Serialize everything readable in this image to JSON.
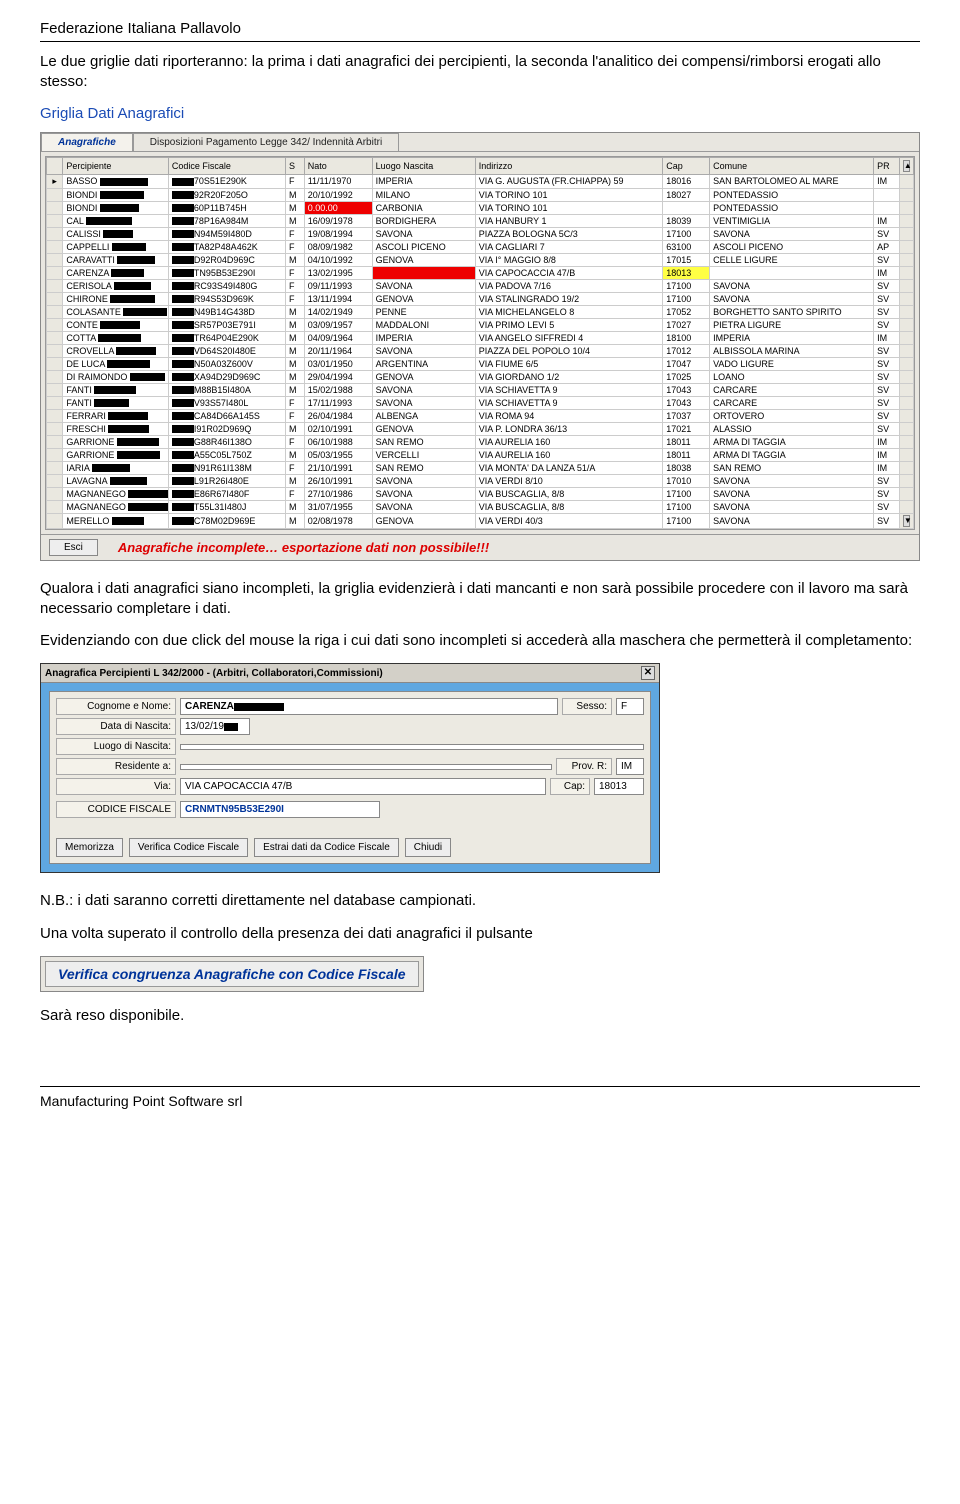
{
  "header": {
    "org": "Federazione Italiana Pallavolo"
  },
  "intro": {
    "p1": "Le due griglie dati riporteranno: la prima i dati anagrafici dei percipienti, la seconda l'analitico dei compensi/rimborsi erogati allo stesso:",
    "section_title": "Griglia Dati Anagrafici"
  },
  "tabs": {
    "active": "Anagrafiche",
    "inactive": "Disposizioni Pagamento Legge 342/ Indennità Arbitri"
  },
  "grid": {
    "columns": [
      "",
      "Percipiente",
      "Codice Fiscale",
      "S",
      "Nato",
      "Luogo Nascita",
      "Indirizzo",
      "Cap",
      "Comune",
      "PR"
    ],
    "rows": [
      {
        "p": "BASSO",
        "cf": "70S51E290K",
        "s": "F",
        "nato": "11/11/1970",
        "luogo": "IMPERIA",
        "ind": "VIA G. AUGUSTA (FR.CHIAPPA) 59",
        "cap": "18016",
        "com": "SAN BARTOLOMEO AL MARE",
        "pr": "IM"
      },
      {
        "p": "BIONDI",
        "cf": "92R20F205O",
        "s": "M",
        "nato": "20/10/1992",
        "luogo": "MILANO",
        "ind": "VIA TORINO 101",
        "cap": "18027",
        "com": "PONTEDASSIO",
        "pr": ""
      },
      {
        "p": "BIONDI",
        "cf": "60P11B745H",
        "s": "M",
        "nato": "",
        "nato_red": true,
        "luogo": "CARBONIA",
        "ind": "VIA TORINO 101",
        "cap": "",
        "com": "PONTEDASSIO",
        "pr": ""
      },
      {
        "p": "CAL",
        "cf": "78P16A984M",
        "s": "M",
        "nato": "16/09/1978",
        "luogo": "BORDIGHERA",
        "ind": "VIA HANBURY   1",
        "cap": "18039",
        "com": "VENTIMIGLIA",
        "pr": "IM"
      },
      {
        "p": "CALISSI",
        "cf": "N94M59I480D",
        "s": "F",
        "nato": "19/08/1994",
        "luogo": "SAVONA",
        "ind": "PIAZZA BOLOGNA 5C/3",
        "cap": "17100",
        "com": "SAVONA",
        "pr": "SV"
      },
      {
        "p": "CAPPELLI",
        "cf": "TA82P48A462K",
        "s": "F",
        "nato": "08/09/1982",
        "luogo": "ASCOLI PICENO",
        "ind": "VIA CAGLIARI 7",
        "cap": "63100",
        "com": "ASCOLI PICENO",
        "pr": "AP"
      },
      {
        "p": "CARAVATTI",
        "cf": "D92R04D969C",
        "s": "M",
        "nato": "04/10/1992",
        "luogo": "GENOVA",
        "ind": "VIA I° MAGGIO 8/8",
        "cap": "17015",
        "com": "CELLE LIGURE",
        "pr": "SV"
      },
      {
        "p": "CARENZA",
        "cf": "TN95B53E290I",
        "s": "F",
        "nato": "13/02/1995",
        "luogo": "",
        "luogo_red": true,
        "ind": "VIA CAPOCACCIA 47/B",
        "cap": "18013",
        "cap_yellow": true,
        "com": "",
        "pr": "IM"
      },
      {
        "p": "CERISOLA",
        "cf": "RC93S49I480G",
        "s": "F",
        "nato": "09/11/1993",
        "luogo": "SAVONA",
        "ind": "VIA PADOVA 7/16",
        "cap": "17100",
        "com": "SAVONA",
        "pr": "SV"
      },
      {
        "p": "CHIRONE",
        "cf": "R94S53D969K",
        "s": "F",
        "nato": "13/11/1994",
        "luogo": "GENOVA",
        "ind": "VIA STALINGRADO 19/2",
        "cap": "17100",
        "com": "SAVONA",
        "pr": "SV"
      },
      {
        "p": "COLASANTE",
        "cf": "N49B14G438D",
        "s": "M",
        "nato": "14/02/1949",
        "luogo": "PENNE",
        "ind": "VIA MICHELANGELO 8",
        "cap": "17052",
        "com": "BORGHETTO SANTO SPIRITO",
        "pr": "SV"
      },
      {
        "p": "CONTE",
        "cf": "SR57P03E791I",
        "s": "M",
        "nato": "03/09/1957",
        "luogo": "MADDALONI",
        "ind": "VIA PRIMO LEVI  5",
        "cap": "17027",
        "com": "PIETRA LIGURE",
        "pr": "SV"
      },
      {
        "p": "COTTA",
        "cf": "TR64P04E290K",
        "s": "M",
        "nato": "04/09/1964",
        "luogo": "IMPERIA",
        "ind": "VIA ANGELO SIFFREDI 4",
        "cap": "18100",
        "com": "IMPERIA",
        "pr": "IM"
      },
      {
        "p": "CROVELLA",
        "cf": "VD64S20I480E",
        "s": "M",
        "nato": "20/11/1964",
        "luogo": "SAVONA",
        "ind": "PIAZZA DEL POPOLO 10/4",
        "cap": "17012",
        "com": "ALBISSOLA MARINA",
        "pr": "SV"
      },
      {
        "p": "DE LUCA",
        "cf": "N50A03Z600V",
        "s": "M",
        "nato": "03/01/1950",
        "luogo": "ARGENTINA",
        "ind": "VIA FIUME 6/5",
        "cap": "17047",
        "com": "VADO LIGURE",
        "pr": "SV"
      },
      {
        "p": "DI RAIMONDO",
        "cf": "XA94D29D969C",
        "s": "M",
        "nato": "29/04/1994",
        "luogo": "GENOVA",
        "ind": "VIA GIORDANO 1/2",
        "cap": "17025",
        "com": "LOANO",
        "pr": "SV"
      },
      {
        "p": "FANTI",
        "cf": "M88B15I480A",
        "s": "M",
        "nato": "15/02/1988",
        "luogo": "SAVONA",
        "ind": "VIA SCHIAVETTA 9",
        "cap": "17043",
        "com": "CARCARE",
        "pr": "SV"
      },
      {
        "p": "FANTI",
        "cf": "V93S57I480L",
        "s": "F",
        "nato": "17/11/1993",
        "luogo": "SAVONA",
        "ind": "VIA SCHIAVETTA 9",
        "cap": "17043",
        "com": "CARCARE",
        "pr": "SV"
      },
      {
        "p": "FERRARI",
        "cf": "CA84D66A145S",
        "s": "F",
        "nato": "26/04/1984",
        "luogo": "ALBENGA",
        "ind": "VIA ROMA 94",
        "cap": "17037",
        "com": "ORTOVERO",
        "pr": "SV"
      },
      {
        "p": "FRESCHI",
        "cf": "I91R02D969Q",
        "s": "M",
        "nato": "02/10/1991",
        "luogo": "GENOVA",
        "ind": "VIA P. LONDRA 36/13",
        "cap": "17021",
        "com": "ALASSIO",
        "pr": "SV"
      },
      {
        "p": "GARRIONE",
        "cf": "G88R46I138O",
        "s": "F",
        "nato": "06/10/1988",
        "luogo": "SAN REMO",
        "ind": "VIA AURELIA 160",
        "cap": "18011",
        "com": "ARMA DI TAGGIA",
        "pr": "IM"
      },
      {
        "p": "GARRIONE",
        "cf": "A55C05L750Z",
        "s": "M",
        "nato": "05/03/1955",
        "luogo": "VERCELLI",
        "ind": "VIA AURELIA 160",
        "cap": "18011",
        "com": "ARMA DI TAGGIA",
        "pr": "IM"
      },
      {
        "p": "IARIA",
        "cf": "N91R61I138M",
        "s": "F",
        "nato": "21/10/1991",
        "luogo": "SAN REMO",
        "ind": "VIA MONTA' DA LANZA 51/A",
        "cap": "18038",
        "com": "SAN REMO",
        "pr": "IM"
      },
      {
        "p": "LAVAGNA",
        "cf": "L91R26I480E",
        "s": "M",
        "nato": "26/10/1991",
        "luogo": "SAVONA",
        "ind": "VIA VERDI 8/10",
        "cap": "17010",
        "com": "SAVONA",
        "pr": "SV"
      },
      {
        "p": "MAGNANEGO",
        "cf": "E86R67I480F",
        "s": "F",
        "nato": "27/10/1986",
        "luogo": "SAVONA",
        "ind": "VIA BUSCAGLIA, 8/8",
        "cap": "17100",
        "com": "SAVONA",
        "pr": "SV"
      },
      {
        "p": "MAGNANEGO",
        "cf": "T55L31I480J",
        "s": "M",
        "nato": "31/07/1955",
        "luogo": "SAVONA",
        "ind": "VIA BUSCAGLIA, 8/8",
        "cap": "17100",
        "com": "SAVONA",
        "pr": "SV"
      },
      {
        "p": "MERELLO",
        "cf": "C78M02D969E",
        "s": "M",
        "nato": "02/08/1978",
        "luogo": "GENOVA",
        "ind": "VIA VERDI 40/3",
        "cap": "17100",
        "com": "SAVONA",
        "pr": "SV"
      }
    ],
    "esci": "Esci",
    "warning": "Anagrafiche incomplete… esportazione dati non possibile!!!"
  },
  "mid_text": {
    "p1": "Qualora i dati anagrafici siano incompleti, la griglia evidenzierà i dati mancanti e non sarà possibile procedere con il lavoro ma sarà necessario completare i dati.",
    "p2": "Evidenziando con due click del mouse la riga i cui dati sono incompleti si accederà alla maschera che permetterà il completamento:"
  },
  "detail": {
    "title": "Anagrafica Percipienti L 342/2000 - (Arbitri, Collaboratori,Commissioni)",
    "labels": {
      "cognome": "Cognome e Nome:",
      "sesso": "Sesso:",
      "data_nascita": "Data di Nascita:",
      "luogo_nascita": "Luogo di Nascita:",
      "residente": "Residente a:",
      "prov": "Prov. R:",
      "via": "Via:",
      "cap": "Cap:",
      "cf": "CODICE FISCALE"
    },
    "values": {
      "cognome": "CARENZA",
      "sesso": "F",
      "data_nascita": "13/02/19",
      "luogo_nascita": "",
      "residente": "",
      "prov": "IM",
      "via": "VIA CAPOCACCIA 47/B",
      "cap": "18013",
      "cf": "CRNMTN95B53E290I"
    },
    "buttons": {
      "memorizza": "Memorizza",
      "verifica_cf": "Verifica Codice Fiscale",
      "estrai": "Estrai dati da Codice Fiscale",
      "chiudi": "Chiudi"
    }
  },
  "bottom": {
    "nb": "N.B.: i dati saranno corretti direttamente nel database campionati.",
    "next": "Una volta superato il controllo della presenza dei dati anagrafici il pulsante",
    "verify_button": "Verifica congruenza Anagrafiche con Codice Fiscale",
    "available": "Sarà reso disponibile."
  },
  "footer": {
    "vendor": "Manufacturing Point Software srl"
  }
}
